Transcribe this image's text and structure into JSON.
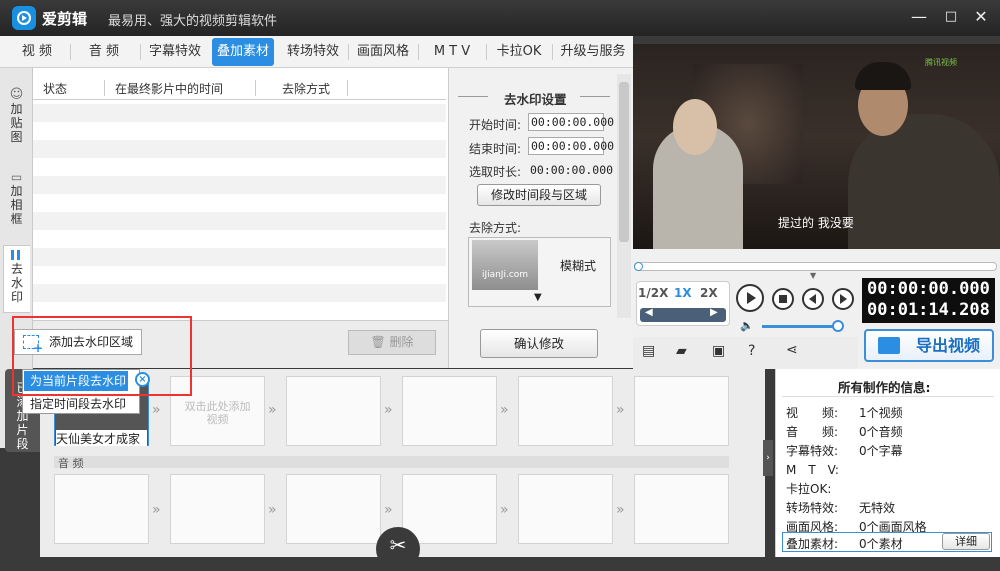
{
  "app": {
    "name": "爱剪辑",
    "slogan": "最易用、强大的视频剪辑软件"
  },
  "window_controls": {
    "minimize": "—",
    "maximize": "□",
    "close": "✕"
  },
  "tabs": [
    "视 频",
    "音 频",
    "字幕特效",
    "叠加素材",
    "转场特效",
    "画面风格",
    "M T V",
    "卡拉OK",
    "升级与服务"
  ],
  "active_tab": "叠加素材",
  "left_tabs": [
    "加贴图",
    "加相框",
    "去水印"
  ],
  "list": {
    "columns": [
      "状态",
      "在最终影片中的时间",
      "去除方式"
    ]
  },
  "buttons": {
    "add_region": "添加去水印区域",
    "delete": "删除",
    "confirm": "确认修改",
    "modify_region": "修改时间段与区域",
    "detail": "详细"
  },
  "popup_menu": {
    "items": [
      "为当前片段去水印",
      "指定时间段去水印"
    ]
  },
  "settings": {
    "title": "去水印设置",
    "start_label": "开始时间:",
    "start_value": "00:00:00.000",
    "end_label": "结束时间:",
    "end_value": "00:00:00.000",
    "duration_label": "选取时长:",
    "duration_value": "00:00:00.000",
    "method_label": "去除方式:",
    "method_value": "模糊式",
    "preview_text": "iJianJi.com"
  },
  "video": {
    "subtitle": "提过的 我没要",
    "watermark": "腾讯视频"
  },
  "player": {
    "speeds": [
      "1/2X",
      "1X",
      "2X"
    ],
    "active_speed": "1X",
    "current_time": "00:00:00.000",
    "total_time": "00:01:14.208"
  },
  "export_label": "导出视频",
  "timeline": {
    "side_label": "已添加片段",
    "clip_title": "天仙美女才成家",
    "add_hint": "双击此处添加视频",
    "audio_label": "音 频"
  },
  "info": {
    "title": "所有制作的信息:",
    "rows": [
      {
        "label": "视　　频:",
        "value": "1个视频"
      },
      {
        "label": "音　　频:",
        "value": "0个音频"
      },
      {
        "label": "字幕特效:",
        "value": "0个字幕"
      },
      {
        "label": "M　T　V:",
        "value": ""
      },
      {
        "label": "卡拉OK:",
        "value": ""
      },
      {
        "label": "转场特效:",
        "value": "无特效"
      },
      {
        "label": "画面风格:",
        "value": "0个画面风格"
      },
      {
        "label": "叠加素材:",
        "value": "0个素材"
      }
    ]
  },
  "colors": {
    "accent": "#2b8ee2",
    "highlight_box": "#e33333",
    "titlebar": "#2e2e2e"
  }
}
